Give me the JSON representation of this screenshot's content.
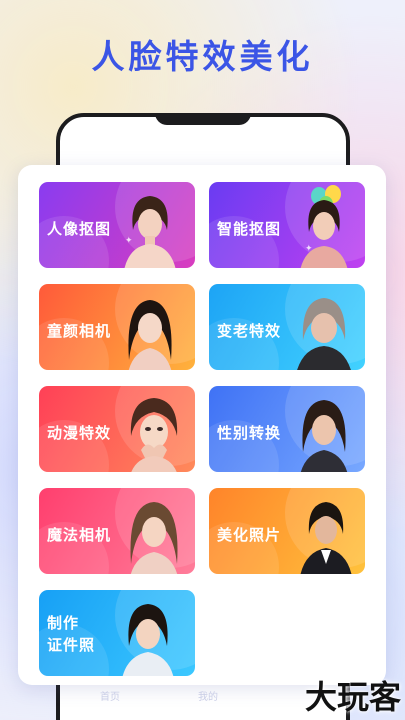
{
  "headline": "人脸特效美化",
  "cards": [
    {
      "id": "portrait-cutout",
      "label": "人像抠图",
      "colors": [
        "#9b3bf0",
        "#d43cc4"
      ]
    },
    {
      "id": "smart-cutout",
      "label": "智能抠图",
      "colors": [
        "#7b3cf2",
        "#c13ff0"
      ]
    },
    {
      "id": "child-face-camera",
      "label": "童颜相机",
      "colors": [
        "#ff6a3a",
        "#ffb13c"
      ]
    },
    {
      "id": "aging-effect",
      "label": "变老特效",
      "colors": [
        "#20a9f5",
        "#3fd0ff"
      ]
    },
    {
      "id": "anime-effect",
      "label": "动漫特效",
      "colors": [
        "#ff4d5e",
        "#ff8a5a"
      ]
    },
    {
      "id": "gender-swap",
      "label": "性别转换",
      "colors": [
        "#4a7cf5",
        "#6fa3ff"
      ]
    },
    {
      "id": "magic-camera",
      "label": "魔法相机",
      "colors": [
        "#ff4b7a",
        "#ff7d9a"
      ]
    },
    {
      "id": "beautify-photo",
      "label": "美化照片",
      "colors": [
        "#ff8a2a",
        "#ffc23c"
      ]
    },
    {
      "id": "id-photo",
      "label_line1": "制作",
      "label_line2": "证件照",
      "colors": [
        "#1fa6f5",
        "#3cc8ff"
      ]
    }
  ],
  "tabs": [
    {
      "label": "首页"
    },
    {
      "label": "我的"
    }
  ],
  "watermark": "大玩客",
  "accent_color": "#3b55e6",
  "icons": [
    "balloons-icon",
    "sparkle-icon",
    "person-portrait-icon"
  ]
}
